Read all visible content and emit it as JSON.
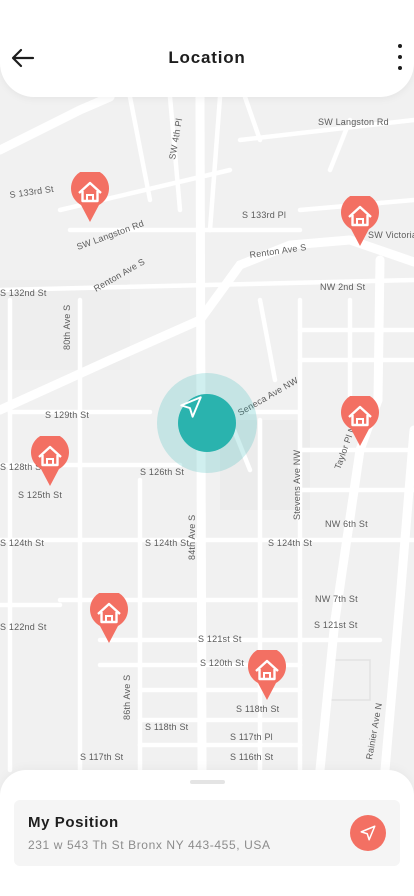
{
  "header": {
    "title": "Location",
    "back_icon": "arrow-left-icon",
    "more_icon": "more-vertical-icon"
  },
  "map": {
    "streets": [
      "SW Langston Rd",
      "S 133rd St",
      "Renton Ave S",
      "S 132nd St",
      "S 129th St",
      "S 126th St",
      "S 124th St",
      "NW 2nd St",
      "NW 6th St",
      "NW 7th St",
      "S 121st St",
      "S 120th St",
      "S 118th St",
      "S 117th Pl",
      "S 117th St",
      "S 116th St",
      "Seneca Ave NW",
      "Taylor Pl NW",
      "Stevens Ave NW",
      "Rainier Ave N",
      "S 133rd Pl",
      "S 135th St",
      "84th Ave S",
      "80th Ave S",
      "86th Ave S",
      "SW Victoria",
      "S 128th St",
      "S 125th St",
      "S 122nd St",
      "SW 4th Pl"
    ],
    "home_pin_icon": "home-pin-icon",
    "my_location_icon": "navigation-arrow-icon"
  },
  "colors": {
    "accent_teal": "#2ab3ae",
    "pin_red": "#f37063",
    "map_background": "#f1f1f1",
    "road": "#ffffff"
  },
  "position_card": {
    "title": "My Position",
    "address": "231 w 543 Th St Bronx NY 443-455, USA",
    "nav_icon": "navigation-arrow-icon"
  }
}
